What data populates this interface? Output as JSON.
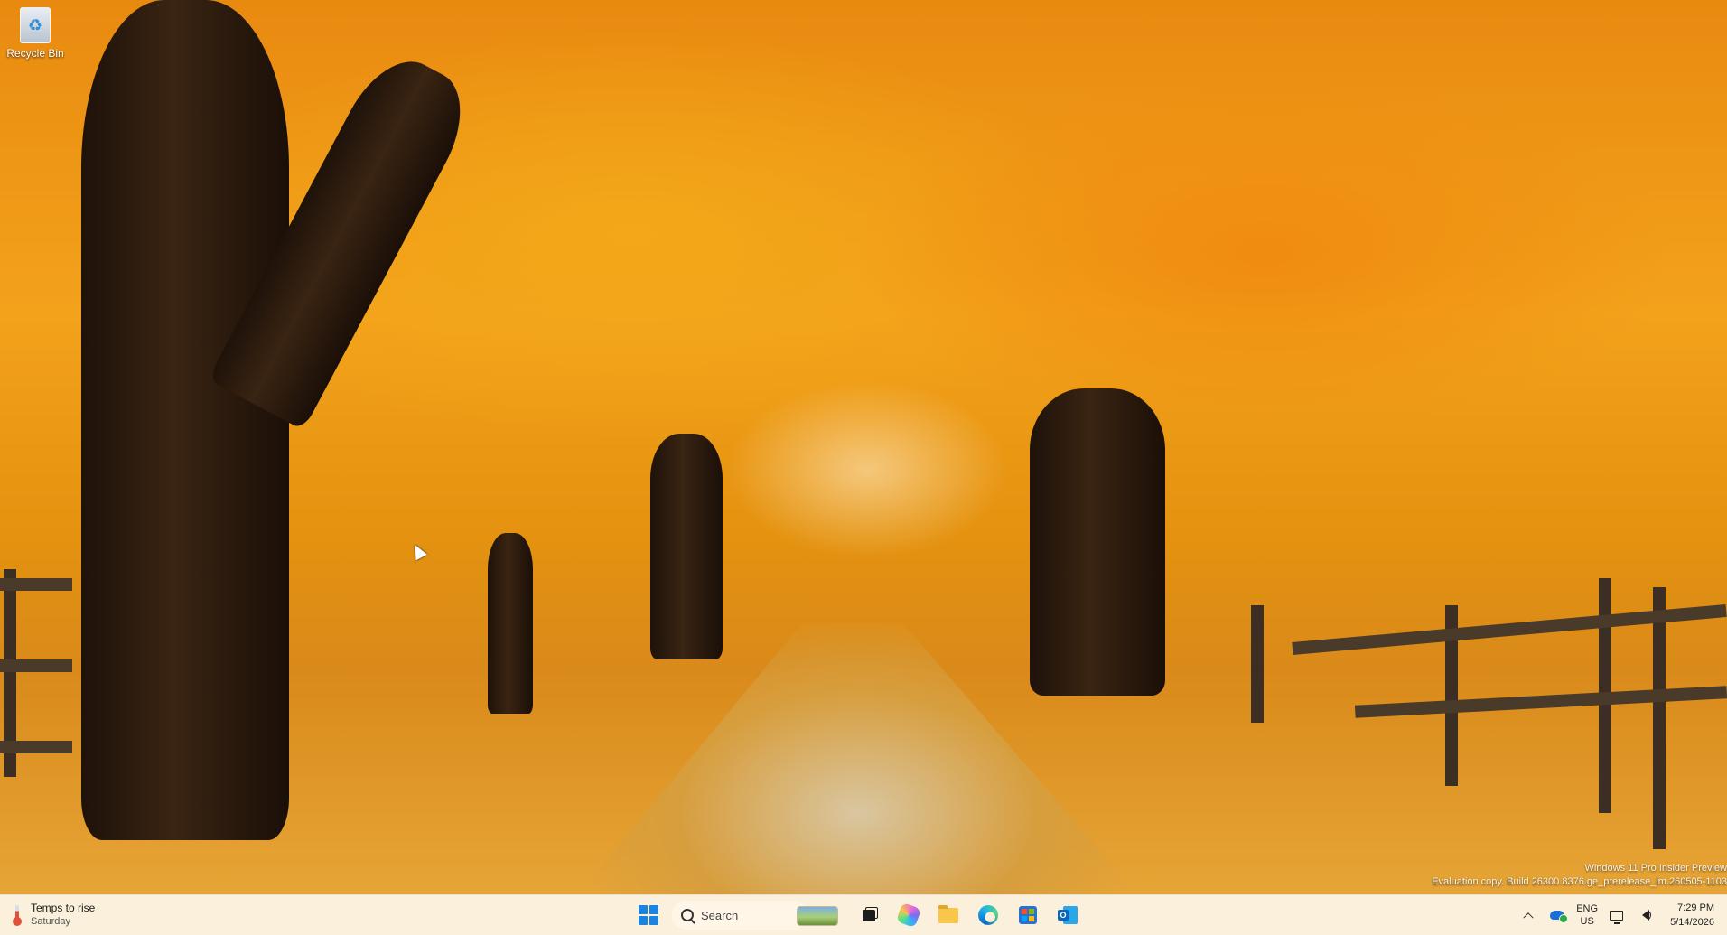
{
  "desktop": {
    "icons": [
      {
        "label": "Recycle Bin",
        "icon": "recycle-bin-icon"
      }
    ],
    "watermark": {
      "line1": "Windows 11 Pro Insider Preview",
      "line2": "Evaluation copy. Build 26300.8376.ge_prerelease_im.260505-1103"
    }
  },
  "taskbar": {
    "weather": {
      "title": "Temps to rise",
      "subtitle": "Saturday",
      "icon": "thermometer-icon"
    },
    "search": {
      "placeholder": "Search"
    },
    "pinned": [
      {
        "name": "Start",
        "icon": "windows-start-icon"
      },
      {
        "name": "Task View",
        "icon": "task-view-icon"
      },
      {
        "name": "Copilot",
        "icon": "copilot-icon"
      },
      {
        "name": "File Explorer",
        "icon": "file-explorer-icon"
      },
      {
        "name": "Microsoft Edge",
        "icon": "edge-icon"
      },
      {
        "name": "Microsoft Store",
        "icon": "store-icon"
      },
      {
        "name": "Outlook",
        "icon": "outlook-icon"
      }
    ],
    "tray": {
      "language_line1": "ENG",
      "language_line2": "US",
      "time": "7:29 PM",
      "date": "5/14/2026"
    },
    "colors": {
      "background": "#fbf0dc",
      "accent": "#1a84e0"
    }
  }
}
